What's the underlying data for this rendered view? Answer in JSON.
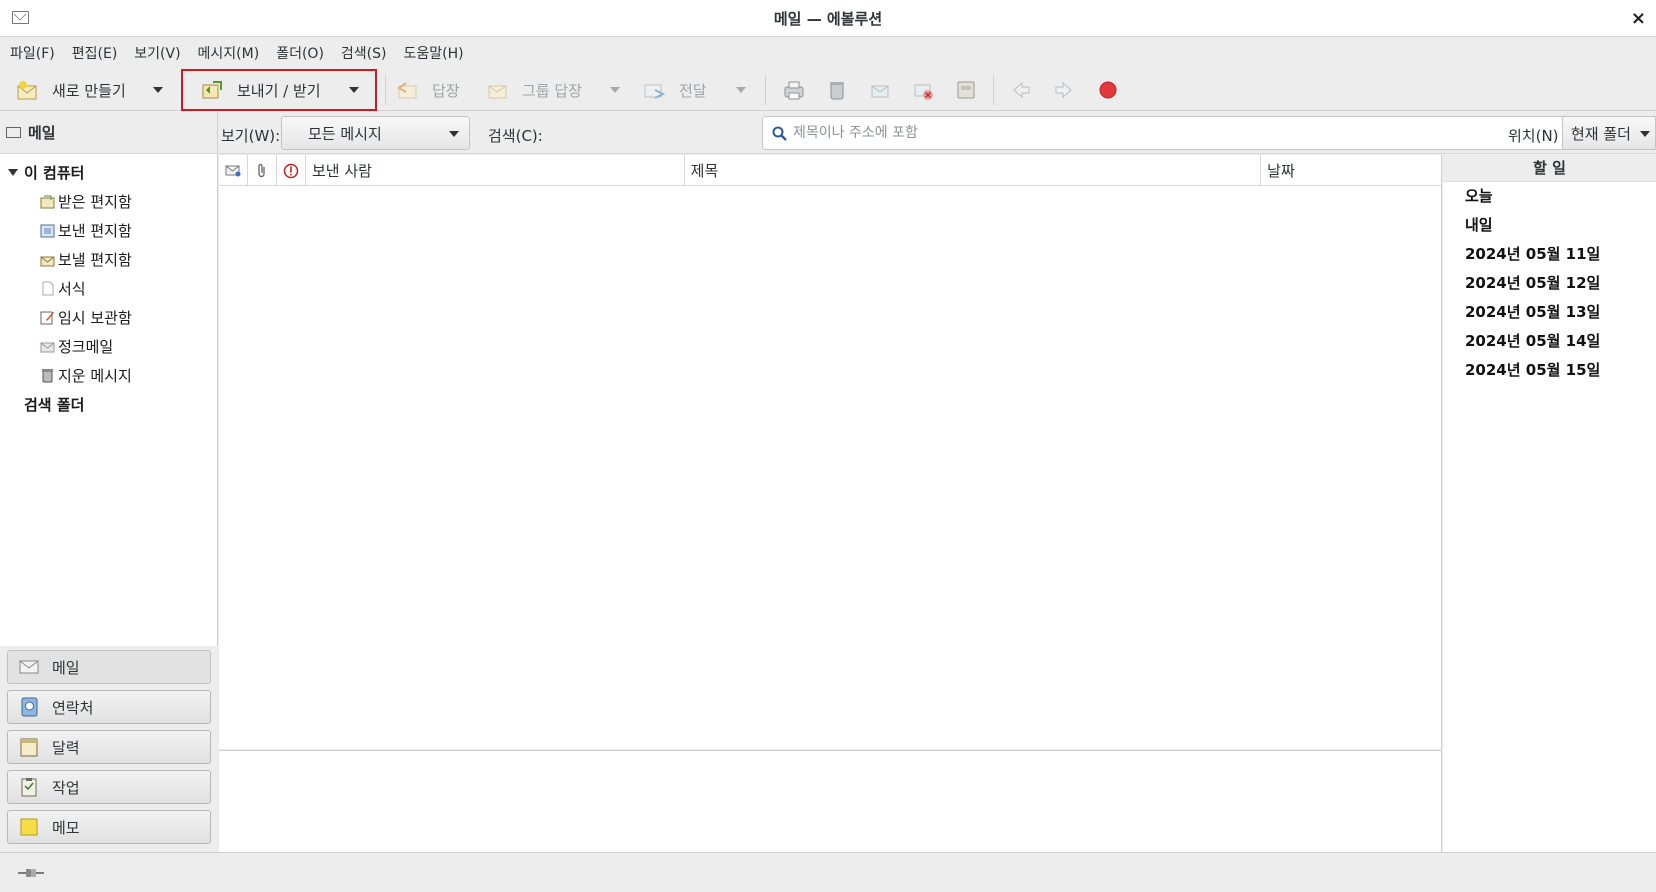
{
  "window": {
    "title": "메일 — 에볼루션",
    "close_label": "×"
  },
  "menubar": [
    "파일(F)",
    "편집(E)",
    "보기(V)",
    "메시지(M)",
    "폴더(O)",
    "검색(S)",
    "도움말(H)"
  ],
  "toolbar": {
    "new_label": "새로 만들기",
    "send_receive_label": "보내기 / 받기",
    "reply_label": "답장",
    "group_reply_label": "그룹 답장",
    "forward_label": "전달"
  },
  "sidebar": {
    "header": "메일",
    "account": "이 컴퓨터",
    "folders": [
      "받은 편지함",
      "보낸 편지함",
      "보낼 편지함",
      "서식",
      "임시 보관함",
      "정크메일",
      "지운 메시지"
    ],
    "search_folders": "검색 폴더"
  },
  "switcher": [
    "메일",
    "연락처",
    "달력",
    "작업",
    "메모"
  ],
  "filter": {
    "view_label": "보기(W):",
    "view_value": "모든 메시지",
    "search_label": "검색(C):",
    "search_placeholder": "제목이나 주소에 포함",
    "scope_label": "위치(N)",
    "scope_value": "현재 폴더"
  },
  "columns": {
    "from": "보낸 사람",
    "subject": "제목",
    "date": "날짜"
  },
  "todo": {
    "header": "할 일",
    "items": [
      "오늘",
      "내일",
      "2024년 05월 11일",
      "2024년 05월 12일",
      "2024년 05월 13일",
      "2024년 05월 14일",
      "2024년 05월 15일"
    ]
  },
  "colors": {
    "highlight_box": "#d0181f",
    "stop_button": "#e2383c"
  }
}
